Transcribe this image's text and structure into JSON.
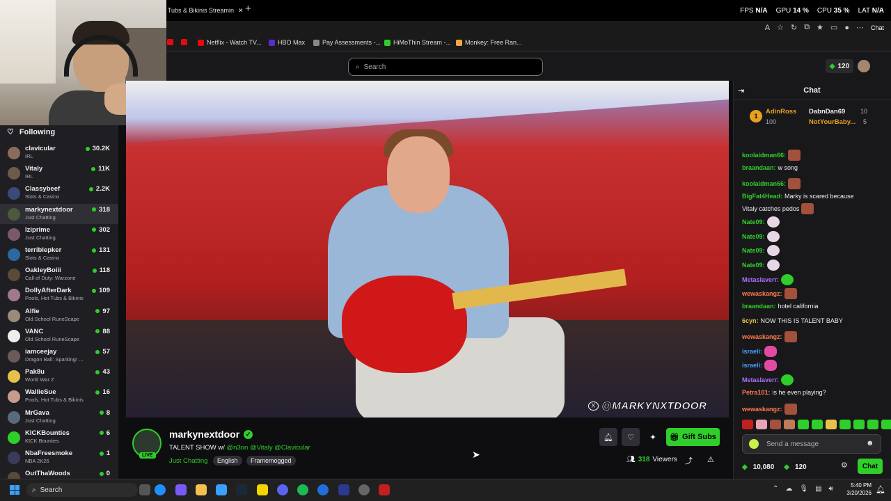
{
  "browser": {
    "tab_title": "t Tubs & Bikinis Streamin",
    "new_tab_icon": "plus-icon",
    "perf": {
      "fps_label": "FPS",
      "fps_value": "N/A",
      "gpu_label": "GPU",
      "gpu_value": "14 %",
      "cpu_label": "CPU",
      "cpu_value": "35 %",
      "lat_label": "LAT",
      "lat_value": "N/A"
    },
    "chat_button": "Chat",
    "bookmarks": [
      {
        "label": "Netflix - Watch TV...",
        "color": "#e50914"
      },
      {
        "label": "HBO Max",
        "color": "#5b2bd1"
      },
      {
        "label": "Pay Assessments -...",
        "color": "#888888"
      },
      {
        "label": "HiMoThin Stream -...",
        "color": "#2fce2a"
      },
      {
        "label": "Monkey: Free Ran...",
        "color": "#f2a73b"
      }
    ]
  },
  "header": {
    "search_placeholder": "Search",
    "points": "120"
  },
  "sidebar": {
    "title": "Following",
    "channels": [
      {
        "name": "clavicular",
        "category": "IRL",
        "viewers": "30.2K",
        "color": "#8b6b5a"
      },
      {
        "name": "Vitaly",
        "category": "IRL",
        "viewers": "11K",
        "color": "#6e5a4a"
      },
      {
        "name": "Classybeef",
        "category": "Slots & Casino",
        "viewers": "2.2K",
        "color": "#3a4a7a"
      },
      {
        "name": "markynextdoor",
        "category": "Just Chatting",
        "viewers": "318",
        "color": "#4a5a3a",
        "active": true
      },
      {
        "name": "Iziprime",
        "category": "Just Chatting",
        "viewers": "302",
        "color": "#7a5a6a"
      },
      {
        "name": "terriblepker",
        "category": "Slots & Casino",
        "viewers": "131",
        "color": "#2a6aa0"
      },
      {
        "name": "OakleyBoiii",
        "category": "Call of Duty: Warzone",
        "viewers": "118",
        "color": "#5a4a3a"
      },
      {
        "name": "DollyAfterDark",
        "category": "Pools, Hot Tubs & Bikinis",
        "viewers": "109",
        "color": "#a07a8a"
      },
      {
        "name": "Alfie",
        "category": "Old School RuneScape",
        "viewers": "97",
        "color": "#9a8a7a"
      },
      {
        "name": "VANC",
        "category": "Old School RuneScape",
        "viewers": "88",
        "color": "#eeeeee"
      },
      {
        "name": "iamceejay",
        "category": "Dragon Ball: Sparking! ...",
        "viewers": "57",
        "color": "#6a5a5a"
      },
      {
        "name": "Pak8u",
        "category": "World War Z",
        "viewers": "43",
        "color": "#e6c24a"
      },
      {
        "name": "WallieSue",
        "category": "Pools, Hot Tubs & Bikinis",
        "viewers": "16",
        "color": "#c89a8a"
      },
      {
        "name": "MrGava",
        "category": "Just Chatting",
        "viewers": "8",
        "color": "#5a6a7a"
      },
      {
        "name": "KICKBounties",
        "category": "KICK Bounties",
        "viewers": "6",
        "color": "#2fce2a"
      },
      {
        "name": "NbaFreesmoke",
        "category": "NBA 2K26",
        "viewers": "1",
        "color": "#3a3a5a"
      },
      {
        "name": "OutThaWoods",
        "category": "",
        "viewers": "0",
        "color": "#5a4a3a"
      }
    ]
  },
  "video": {
    "watermark": "@MARKYNXTDOOR"
  },
  "stream": {
    "name": "markynextdoor",
    "live_badge": "LIVE",
    "title_prefix": "TALENT SHOW w/ ",
    "title_mentions": "@n3on @Vitaly @Clavicular",
    "category": "Just Chatting",
    "tags": [
      "English",
      "Framemogged"
    ],
    "gift_subs": "Gift Subs",
    "viewers": "318",
    "viewers_label": "Viewers"
  },
  "chat": {
    "title": "Chat",
    "leaderboard": {
      "rank": "1",
      "first_name": "AdinRoss",
      "first_value": "100",
      "second_name": "DabnDan69",
      "second_value": "10",
      "third_name": "NotYourBaby...",
      "third_value": "5"
    },
    "messages": [
      {
        "user": "koolaidman66:",
        "color": "#2fce2a",
        "text": "",
        "emote": "red"
      },
      {
        "user": "braandaan:",
        "color": "#2fce2a",
        "text": "w song",
        "emote": ""
      },
      {
        "user": "koolaidman66:",
        "color": "#2fce2a",
        "text": "",
        "emote": "red"
      },
      {
        "user": "BigFat4Head:",
        "color": "#2fce2a",
        "text": "Marky is scared because",
        "emote": ""
      },
      {
        "user": "",
        "color": "#efeff1",
        "text": "Vitaly catches pedos",
        "emote": "red"
      },
      {
        "user": "Nate09:",
        "color": "#2fce2a",
        "text": "",
        "emote": "cat"
      },
      {
        "user": "Nate09:",
        "color": "#2fce2a",
        "text": "",
        "emote": "cat"
      },
      {
        "user": "Nate09:",
        "color": "#2fce2a",
        "text": "",
        "emote": "cat"
      },
      {
        "user": "Nate09:",
        "color": "#2fce2a",
        "text": "",
        "emote": "cat"
      },
      {
        "user": "Metaslaverr:",
        "color": "#a970ff",
        "text": "",
        "emote": "frog"
      },
      {
        "user": "wewaskangz:",
        "color": "#ff7a4a",
        "text": "",
        "emote": "red"
      },
      {
        "user": "braandaan:",
        "color": "#2fce2a",
        "text": "hotel california",
        "emote": ""
      },
      {
        "user": "6cyn:",
        "color": "#e6c24a",
        "text": "NOW THIS IS TALENT BABY",
        "emote": ""
      },
      {
        "user": "wewaskangz:",
        "color": "#ff7a4a",
        "text": "",
        "emote": "red"
      },
      {
        "user": "israeli:",
        "color": "#4aa0ff",
        "text": "",
        "emote": "heart"
      },
      {
        "user": "israeli:",
        "color": "#4aa0ff",
        "text": "",
        "emote": "heart"
      },
      {
        "user": "Metaslaverr:",
        "color": "#a970ff",
        "text": "",
        "emote": "frog"
      },
      {
        "user": "Petra101:",
        "color": "#ff7a4a",
        "text": "is he even playing?",
        "emote": ""
      },
      {
        "user": "wewaskangz:",
        "color": "#ff7a4a",
        "text": "",
        "emote": "red"
      }
    ],
    "input_placeholder": "Send a message",
    "balance": "10,080",
    "points": "120",
    "send_label": "Chat"
  },
  "taskbar": {
    "search": "Search",
    "time": "5:40 PM",
    "date": "3/20/2026"
  }
}
